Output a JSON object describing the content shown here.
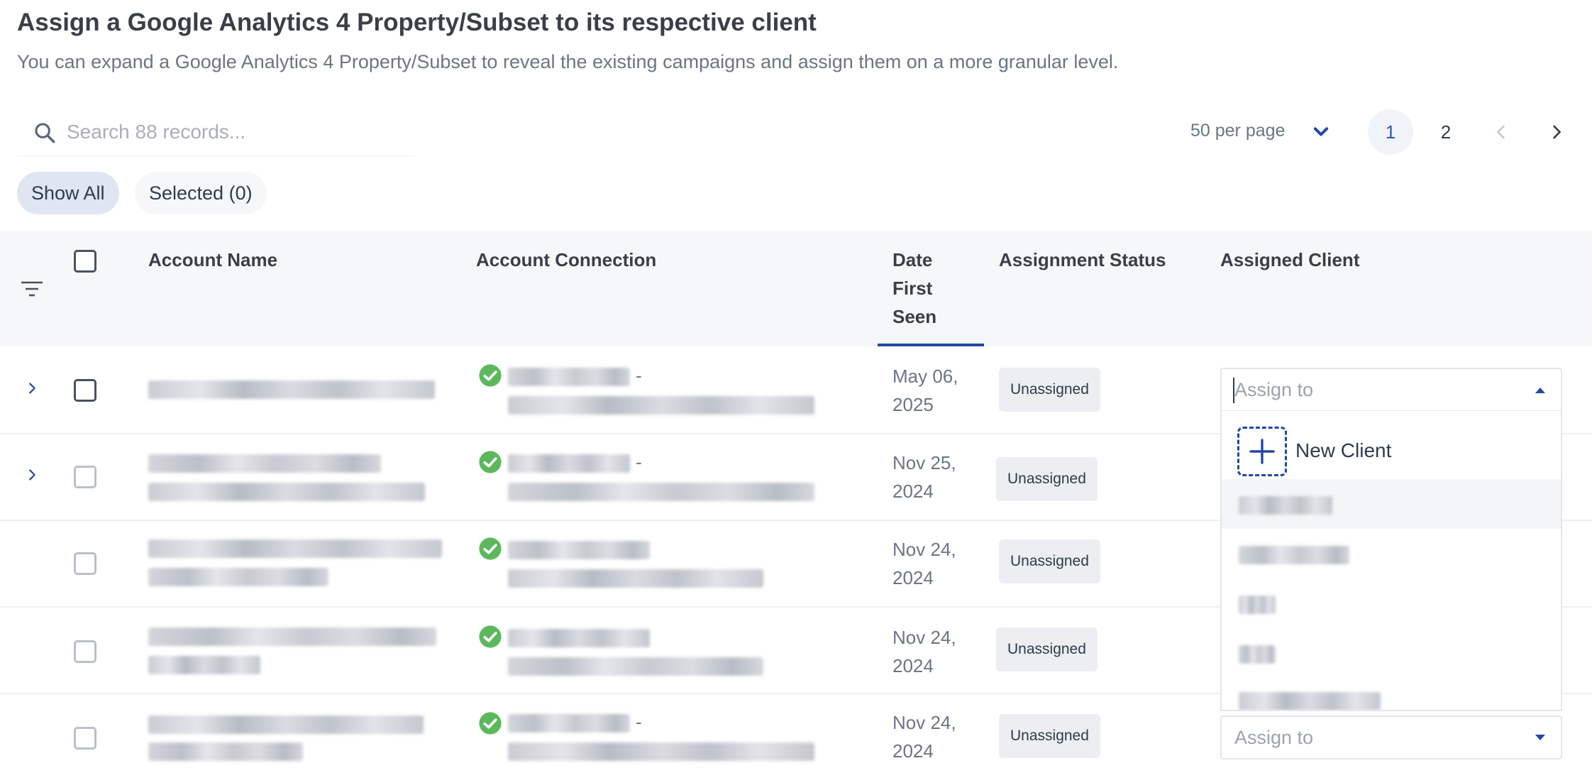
{
  "header": {
    "title": "Assign a Google Analytics 4 Property/Subset to its respective client",
    "subtitle": "You can expand a Google Analytics 4 Property/Subset to reveal the existing campaigns and assign them on a more granular level."
  },
  "search": {
    "placeholder": "Search 88 records..."
  },
  "pagination": {
    "per_page": "50 per page",
    "pages": [
      "1",
      "2"
    ],
    "current_page": "1"
  },
  "filters": {
    "show_all": "Show All",
    "selected": "Selected (0)"
  },
  "table": {
    "columns": {
      "account_name": "Account Name",
      "account_connection": "Account Connection",
      "date_first_seen": "Date First Seen",
      "assignment_status": "Assignment Status",
      "assigned_client": "Assigned Client"
    },
    "rows": [
      {
        "date": "May 06, 2025",
        "status": "Unassigned",
        "expandable": true
      },
      {
        "date": "Nov 25, 2024",
        "status": "Unassigned",
        "expandable": true
      },
      {
        "date": "Nov 24, 2024",
        "status": "Unassigned",
        "expandable": false
      },
      {
        "date": "Nov 24, 2024",
        "status": "Unassigned",
        "expandable": false
      },
      {
        "date": "Nov 24, 2024",
        "status": "Unassigned",
        "expandable": false
      }
    ]
  },
  "assign": {
    "placeholder": "Assign to",
    "new_client": "New Client"
  },
  "colors": {
    "accent": "#2447a5",
    "success": "#5cb85c",
    "header_bg": "#f6f7f8"
  },
  "icons": [
    "search-icon",
    "chevron-down-icon",
    "chevron-left-icon",
    "chevron-right-icon",
    "filter-icon",
    "check-circle-icon",
    "plus-icon",
    "caret-up-icon",
    "caret-down-icon"
  ]
}
